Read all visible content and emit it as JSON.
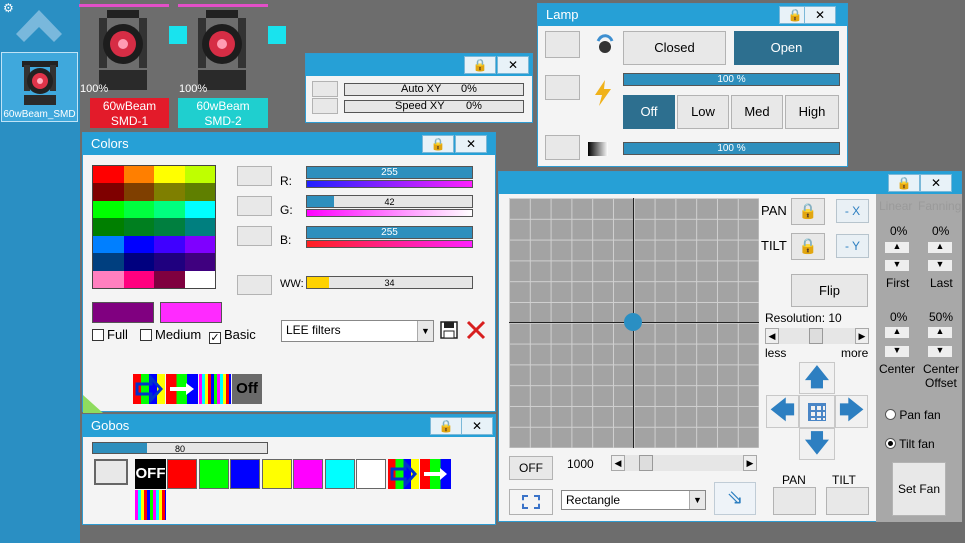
{
  "sidebar": {
    "gear_icon": "gear-icon",
    "up_icon": "chevron-up-icon",
    "fixture_label": "60wBeam_SMD"
  },
  "fixtures": [
    {
      "pct": "100%",
      "name1": "60wBeam",
      "name2": "SMD-1",
      "color": "#e31b2a"
    },
    {
      "pct": "100%",
      "name1": "60wBeam",
      "name2": "SMD-2",
      "color": "#1fcfcf"
    }
  ],
  "autoxy": {
    "rows": [
      {
        "label": "Auto XY",
        "value": "0%"
      },
      {
        "label": "Speed XY",
        "value": "0%"
      }
    ]
  },
  "lamp": {
    "title": "Lamp",
    "closed": "Closed",
    "open": "Open",
    "bar1": "100 %",
    "bar1_level": 1.0,
    "power": {
      "off": "Off",
      "low": "Low",
      "med": "Med",
      "high": "High"
    },
    "bar2": "100 %",
    "bar2_level": 1.0
  },
  "colors": {
    "title": "Colors",
    "palette": [
      [
        "#ff0000",
        "#ff7f00",
        "#ffff00",
        "#bfff00"
      ],
      [
        "#7f0000",
        "#7f3f00",
        "#7f7f00",
        "#5f7f00"
      ],
      [
        "#00ff00",
        "#00ff3f",
        "#00ff7f",
        "#00ffff"
      ],
      [
        "#007f00",
        "#007f1f",
        "#007f3f",
        "#007f7f"
      ],
      [
        "#007fff",
        "#0000ff",
        "#3f00ff",
        "#7f00ff"
      ],
      [
        "#003f7f",
        "#00007f",
        "#1f007f",
        "#3f007f"
      ],
      [
        "#ff7fbf",
        "#ff007f",
        "#7f003f",
        "#ffffff"
      ]
    ],
    "r_label": "R:",
    "r_value": "255",
    "r_level": 1.0,
    "g_label": "G:",
    "g_value": "42",
    "g_level": 0.165,
    "b_label": "B:",
    "b_value": "255",
    "b_level": 1.0,
    "ww_label": "WW:",
    "ww_value": "34",
    "ww_level": 0.133,
    "swatch1": "#800080",
    "swatch2": "#ff2aff",
    "full": "Full",
    "medium": "Medium",
    "basic": "Basic",
    "filter": "LEE filters",
    "off_label": "Off"
  },
  "gobos": {
    "title": "Gobos",
    "bar_value": "80",
    "bar_level": 0.31,
    "off_label": "OFF",
    "swatches": [
      "#ff0000",
      "#00ff00",
      "#0000ff",
      "#ffff00",
      "#ff00ff",
      "#00ffff",
      "#ffffff"
    ]
  },
  "pantilt": {
    "pan": "PAN",
    "tilt": "TILT",
    "minus_x": "- X",
    "minus_y": "- Y",
    "flip": "Flip",
    "resolution": "Resolution: 10",
    "less": "less",
    "more": "more",
    "off": "OFF",
    "speed": "1000",
    "shape": "Rectangle",
    "pan_btn": "PAN",
    "tilt_btn": "TILT",
    "fanning": {
      "linear": "Linear",
      "fanning": "Fanning",
      "first_pct": "0%",
      "last_pct": "0%",
      "first": "First",
      "last": "Last",
      "center_pct": "0%",
      "offset_pct": "50%",
      "center": "Center",
      "center_offset1": "Center",
      "center_offset2": "Offset",
      "pan_fan": "Pan fan",
      "tilt_fan": "Tilt fan",
      "set_fan": "Set Fan"
    }
  }
}
